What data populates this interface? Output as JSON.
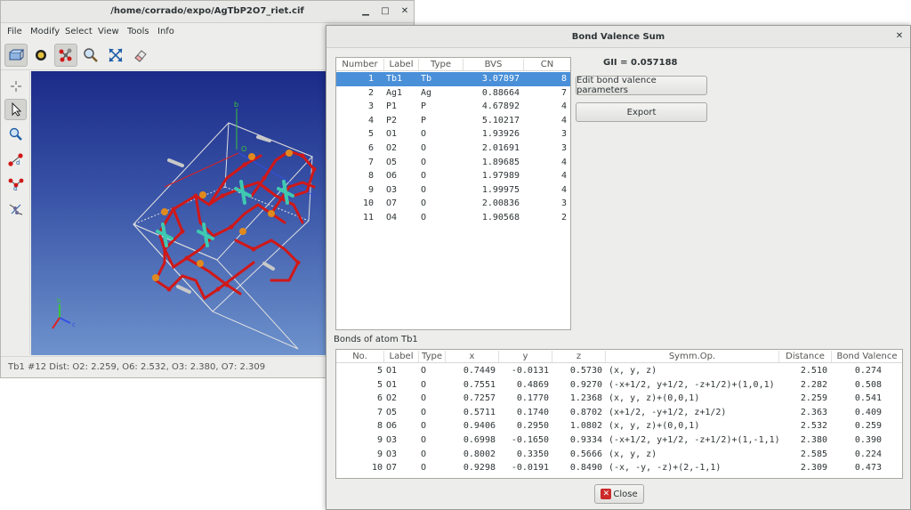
{
  "viewer": {
    "title": "/home/corrado/expo/AgTbP2O7_riet.cif",
    "menu": [
      "File",
      "Modify",
      "Select",
      "View",
      "Tools",
      "Info"
    ],
    "status": "Tb1 #12 Dist: O2: 2.259, O6: 2.532, O3: 2.380, O7: 2.309",
    "axis_labels": {
      "b": "b",
      "o": "O",
      "c": "c"
    },
    "colors": {
      "bg_top": "#1a2a88",
      "bg_bottom": "#6d92cc",
      "tb": "#3ec9b0",
      "p": "#e08a1e",
      "o": "#d01818",
      "ag": "#c8c8c8"
    }
  },
  "dialog": {
    "title": "Bond Valence Sum",
    "close_glyph": "✕",
    "gii_label": "GII = 0.057188",
    "buttons": {
      "edit": "Edit bond valence parameters",
      "export": "Export",
      "close": "Close"
    },
    "bvs_table": {
      "headers": [
        "Number",
        "Label",
        "Type",
        "BVS",
        "CN"
      ],
      "rows": [
        [
          "1",
          "Tb1",
          "Tb",
          "3.07897",
          "8"
        ],
        [
          "2",
          "Ag1",
          "Ag",
          "0.88664",
          "7"
        ],
        [
          "3",
          "P1",
          "P",
          "4.67892",
          "4"
        ],
        [
          "4",
          "P2",
          "P",
          "5.10217",
          "4"
        ],
        [
          "5",
          "O1",
          "O",
          "1.93926",
          "3"
        ],
        [
          "6",
          "O2",
          "O",
          "2.01691",
          "3"
        ],
        [
          "7",
          "O5",
          "O",
          "1.89685",
          "4"
        ],
        [
          "8",
          "O6",
          "O",
          "1.97989",
          "4"
        ],
        [
          "9",
          "O3",
          "O",
          "1.99975",
          "4"
        ],
        [
          "10",
          "O7",
          "O",
          "2.00836",
          "3"
        ],
        [
          "11",
          "O4",
          "O",
          "1.90568",
          "2"
        ]
      ],
      "selected_index": 0
    },
    "bonds_section_label": "Bonds of atom Tb1",
    "bonds_table": {
      "headers": [
        "No.",
        "Label",
        "Type",
        "x",
        "y",
        "z",
        "Symm.Op.",
        "Distance",
        "Bond Valence"
      ],
      "rows": [
        [
          "5",
          "O1",
          "O",
          "0.7449",
          "-0.0131",
          "0.5730",
          "(x, y, z)",
          "2.510",
          "0.274"
        ],
        [
          "5",
          "O1",
          "O",
          "0.7551",
          "0.4869",
          "0.9270",
          "(-x+1/2, y+1/2, -z+1/2)+(1,0,1)",
          "2.282",
          "0.508"
        ],
        [
          "6",
          "O2",
          "O",
          "0.7257",
          "0.1770",
          "1.2368",
          "(x, y, z)+(0,0,1)",
          "2.259",
          "0.541"
        ],
        [
          "7",
          "O5",
          "O",
          "0.5711",
          "0.1740",
          "0.8702",
          "(x+1/2, -y+1/2, z+1/2)",
          "2.363",
          "0.409"
        ],
        [
          "8",
          "O6",
          "O",
          "0.9406",
          "0.2950",
          "1.0802",
          "(x, y, z)+(0,0,1)",
          "2.532",
          "0.259"
        ],
        [
          "9",
          "O3",
          "O",
          "0.6998",
          "-0.1650",
          "0.9334",
          "(-x+1/2, y+1/2, -z+1/2)+(1,-1,1)",
          "2.380",
          "0.390"
        ],
        [
          "9",
          "O3",
          "O",
          "0.8002",
          "0.3350",
          "0.5666",
          "(x, y, z)",
          "2.585",
          "0.224"
        ],
        [
          "10",
          "O7",
          "O",
          "0.9298",
          "-0.0191",
          "0.8490",
          "(-x, -y, -z)+(2,-1,1)",
          "2.309",
          "0.473"
        ]
      ]
    }
  }
}
